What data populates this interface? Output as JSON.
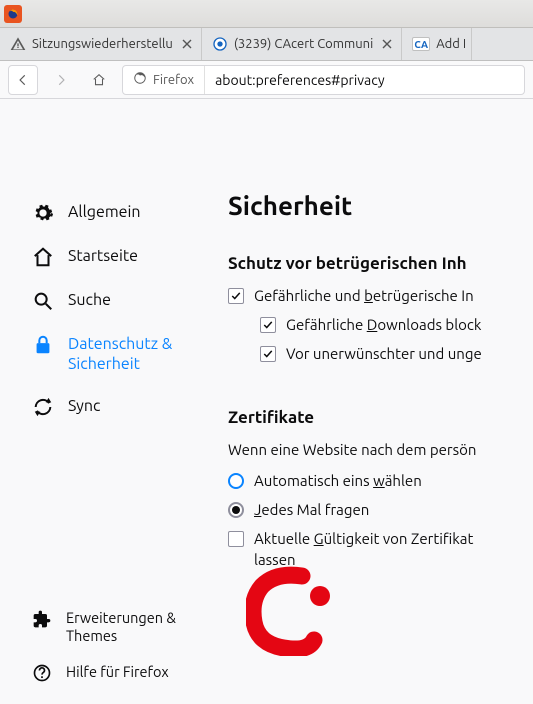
{
  "tabs": [
    {
      "label": "Sitzungswiederherstellu",
      "icon": "warning"
    },
    {
      "label": "(3239) CAcert Communi",
      "icon": "cacert"
    },
    {
      "label": "Add New",
      "icon": "ca-badge"
    }
  ],
  "toolbar": {
    "identity_label": "Firefox",
    "url": "about:preferences#privacy"
  },
  "sidebar": {
    "items": [
      {
        "label": "Allgemein"
      },
      {
        "label": "Startseite"
      },
      {
        "label": "Suche"
      },
      {
        "label": "Datenschutz & Sicherheit"
      },
      {
        "label": "Sync"
      }
    ],
    "bottom": [
      {
        "label": "Erweiterungen & Themes"
      },
      {
        "label": "Hilfe für Firefox"
      }
    ]
  },
  "main": {
    "heading": "Sicherheit",
    "section1": {
      "title": "Schutz vor betrügerischen Inh",
      "opt1_pre": "Gefährliche und ",
      "opt1_u": "b",
      "opt1_post": "etrügerische In",
      "opt2_pre": "Gefährliche ",
      "opt2_u": "D",
      "opt2_post": "ownloads block",
      "opt3": "Vor unerwünschter und unge"
    },
    "section2": {
      "title": "Zertifikate",
      "intro": "Wenn eine Website nach dem persön",
      "radio1_pre": "Automatisch eins ",
      "radio1_u": "w",
      "radio1_post": "ählen",
      "radio2_u": "J",
      "radio2_post": "edes Mal fragen",
      "check_pre": "Aktuelle ",
      "check_u": "G",
      "check_post": "ültigkeit von Zertifikat",
      "check_line2": "lassen"
    }
  }
}
